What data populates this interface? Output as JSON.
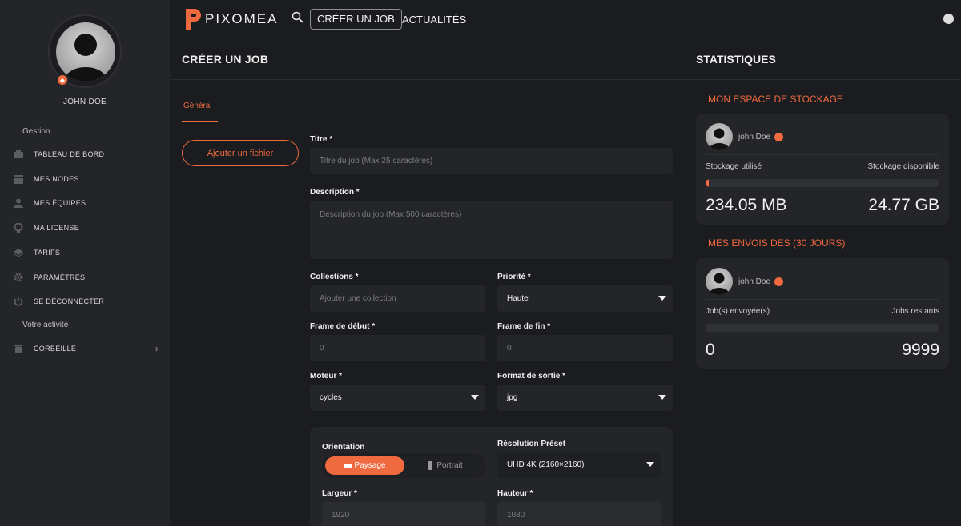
{
  "brand": {
    "name": "PIXOMEA",
    "accent": "#ef6a3f"
  },
  "sidebar": {
    "username": "JOHN DOE",
    "section_gestion": "Gestion",
    "items": [
      {
        "label": "TABLEAU DE BORD",
        "icon": "dashboard-icon"
      },
      {
        "label": "MES NODES",
        "icon": "nodes-icon"
      },
      {
        "label": "MES ÉQUIPES",
        "icon": "user-icon"
      },
      {
        "label": "MA LICENSE",
        "icon": "license-icon"
      },
      {
        "label": "TARIFS",
        "icon": "tag-icon"
      },
      {
        "label": "PARAMÈTRES",
        "icon": "gear-icon"
      },
      {
        "label": "SE DÉCONNECTER",
        "icon": "power-icon"
      }
    ],
    "section_activity": "Votre activité",
    "trash": {
      "label": "CORBEILLE",
      "icon": "trash-icon"
    }
  },
  "topbar": {
    "active_link": "CRÉER UN JOB",
    "link_news": "ACTUALITÉS"
  },
  "main": {
    "title": "CRÉER UN JOB",
    "tab_general": "Général",
    "add_file_button": "Ajouter un fichier",
    "fields": {
      "title_label": "Titre *",
      "title_placeholder": "Titre du job (Max 25 caractères)",
      "description_label": "Description *",
      "description_placeholder": "Description du job (Max 500 caractères)",
      "collections_label": "Collections *",
      "collections_placeholder": "Ajouter une collection",
      "priority_label": "Priorité *",
      "priority_value": "Haute",
      "frame_start_label": "Frame de début *",
      "frame_start_value": "0",
      "frame_end_label": "Frame de fin *",
      "frame_end_value": "0",
      "engine_label": "Moteur *",
      "engine_value": "cycles",
      "output_label": "Format de sortie *",
      "output_value": "jpg"
    },
    "resolution": {
      "orientation_label": "Orientation",
      "landscape": "Paysage",
      "portrait": "Portrait",
      "preset_label": "Résolution Préset",
      "preset_value": "UHD 4K (2160×2160)",
      "width_label": "Largeur *",
      "width_value": "1920",
      "height_label": "Hauteur *",
      "height_value": "1080"
    }
  },
  "stats": {
    "title": "STATISTIQUES",
    "storage": {
      "heading": "MON ESPACE DE STOCKAGE",
      "user": "john Doe",
      "used_label": "Stockage utilisé",
      "available_label": "Stockage disponible",
      "used_value": "234.05 MB",
      "available_value": "24.77 GB",
      "usage_fraction": 0.01
    },
    "uploads": {
      "heading": "MES ENVOIS DES (30 JOURS)",
      "user": "john Doe",
      "sent_label": "Job(s) envoyée(s)",
      "remaining_label": "Jobs restants",
      "sent_value": "0",
      "remaining_value": "9999",
      "usage_fraction": 0
    }
  }
}
